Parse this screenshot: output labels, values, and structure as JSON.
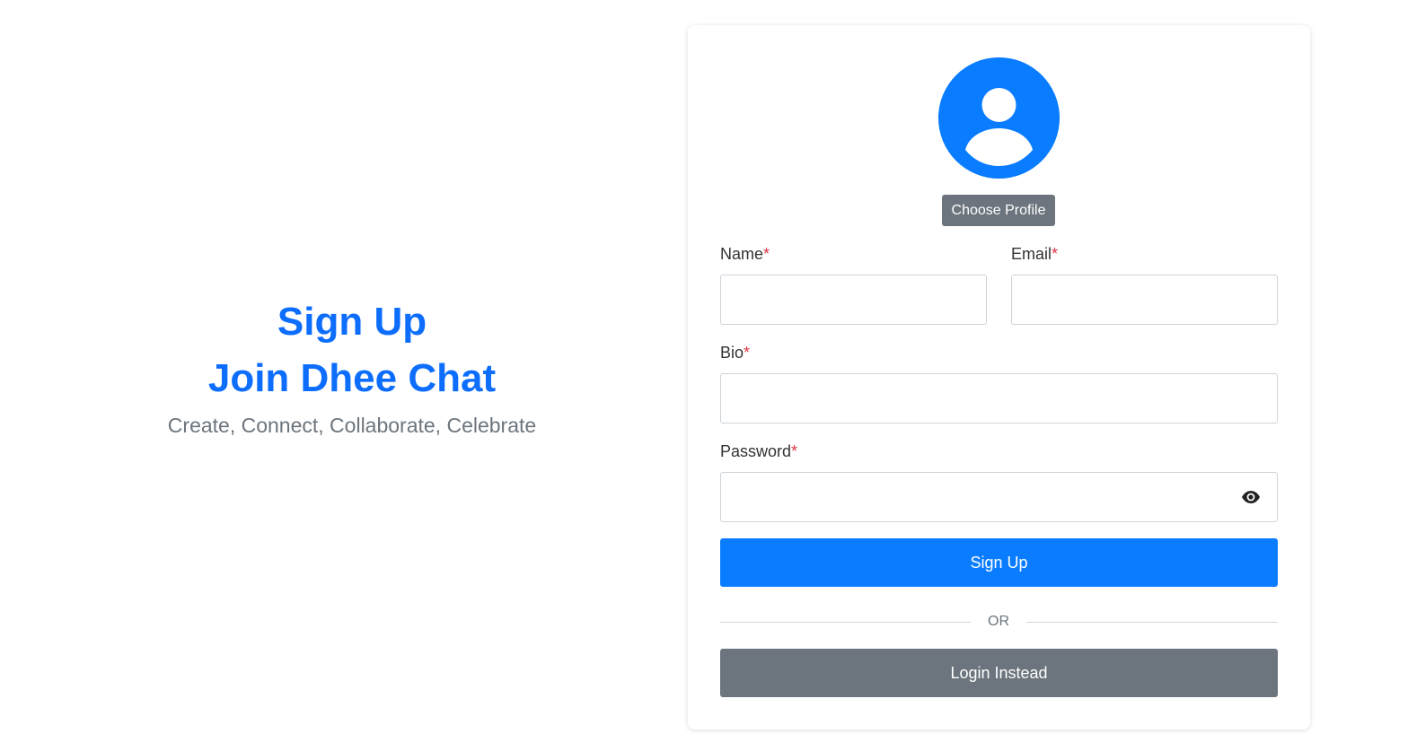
{
  "hero": {
    "title_line1": "Sign Up",
    "title_line2": "Join Dhee Chat",
    "subtitle": "Create, Connect, Collaborate, Celebrate"
  },
  "profile": {
    "avatar_icon": "user-circle-icon",
    "choose_label": "Choose Profile"
  },
  "form": {
    "name": {
      "label": "Name",
      "required_mark": "*",
      "value": ""
    },
    "email": {
      "label": "Email",
      "required_mark": "*",
      "value": ""
    },
    "bio": {
      "label": "Bio",
      "required_mark": "*",
      "value": ""
    },
    "password": {
      "label": "Password",
      "required_mark": "*",
      "value": "",
      "toggle_icon": "eye-icon"
    },
    "submit_label": "Sign Up",
    "divider_text": "OR",
    "login_label": "Login Instead"
  },
  "colors": {
    "primary": "#0a7cff",
    "secondary": "#6c757d",
    "required": "#dc3545",
    "heading": "#0d6efd"
  }
}
